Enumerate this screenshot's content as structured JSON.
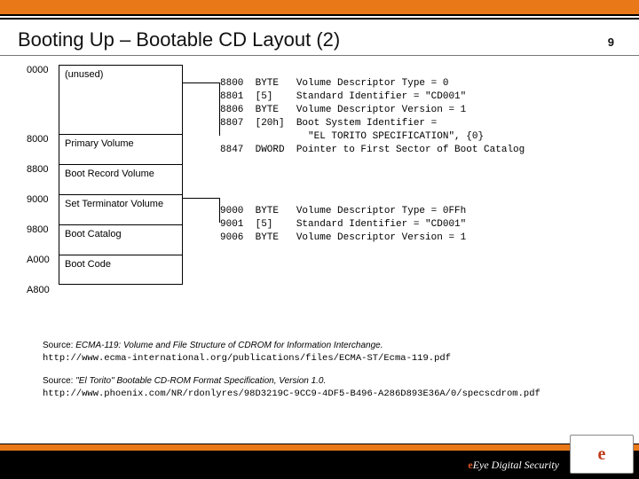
{
  "header": {
    "title": "Booting Up – Bootable CD Layout (2)",
    "page_number": "9"
  },
  "offsets": [
    "0000",
    "8000",
    "8800",
    "9000",
    "9800",
    "A000",
    "A800"
  ],
  "boxes": {
    "unused": "(unused)",
    "primary": "Primary Volume",
    "bootrecord": "Boot Record Volume",
    "terminator": "Set Terminator Volume",
    "catalog": "Boot Catalog",
    "bootcode": "Boot Code"
  },
  "details1": [
    {
      "off": "8800",
      "type": "BYTE",
      "desc": "Volume Descriptor Type = 0"
    },
    {
      "off": "8801",
      "type": "[5]",
      "desc": "Standard Identifier = \"CD001\""
    },
    {
      "off": "8806",
      "type": "BYTE",
      "desc": "Volume Descriptor Version = 1"
    },
    {
      "off": "8807",
      "type": "[20h]",
      "desc": "Boot System Identifier ="
    },
    {
      "off": "",
      "type": "",
      "desc": "  \"EL TORITO SPECIFICATION\", {0}"
    },
    {
      "off": "8847",
      "type": "DWORD",
      "desc": "Pointer to First Sector of Boot Catalog"
    }
  ],
  "details2": [
    {
      "off": "9000",
      "type": "BYTE",
      "desc": "Volume Descriptor Type = 0FFh"
    },
    {
      "off": "9001",
      "type": "[5]",
      "desc": "Standard Identifier = \"CD001\""
    },
    {
      "off": "9006",
      "type": "BYTE",
      "desc": "Volume Descriptor Version = 1"
    }
  ],
  "sources": {
    "s1_label": "Source: ",
    "s1_italic": "ECMA-119: Volume and File Structure of CDROM for Information Interchange.",
    "s1_url": "http://www.ecma-international.org/publications/files/ECMA-ST/Ecma-119.pdf",
    "s2_label": "Source: ",
    "s2_italic": "\"El Torito\" Bootable CD-ROM Format Specification, Version 1.0.",
    "s2_url": "http://www.phoenix.com/NR/rdonlyres/98D3219C-9CC9-4DF5-B496-A286D893E36A/0/specscdrom.pdf"
  },
  "footer": {
    "brand_e": "e",
    "brand_rest": "Eye Digital Security",
    "logo": "e"
  }
}
